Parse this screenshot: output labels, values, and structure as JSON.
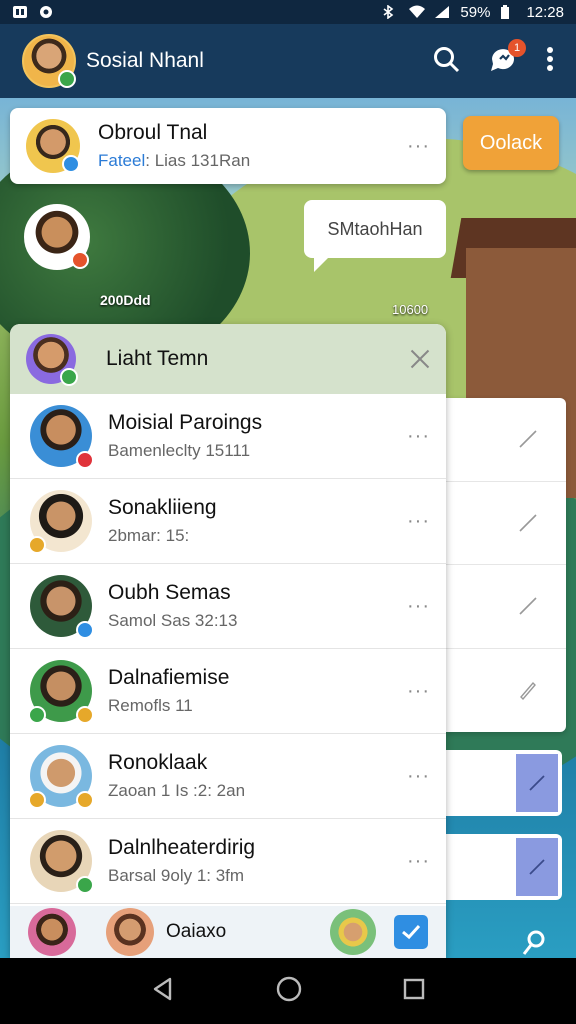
{
  "status_bar": {
    "battery": "59%",
    "time": "12:28"
  },
  "app_bar": {
    "title": "Sosial Nhanl",
    "notification_count": "1"
  },
  "top_card": {
    "name": "Obroul Tnal",
    "sub_highlight": "Fateel",
    "sub_rest": ": Lias 131Ran",
    "menu": "···"
  },
  "orange_button": "Oolack",
  "speech_bubble": "SMtaohHan",
  "scene_labels": {
    "left": "200Ddd",
    "right": "10600"
  },
  "panel": {
    "title": "Liaht Temn",
    "rows": [
      {
        "name": "Moisial Paroings",
        "sub": "Bamenleclty 15111",
        "menu": "···"
      },
      {
        "name": "Sonakliieng",
        "sub": "2bmar: 15:",
        "menu": "···"
      },
      {
        "name": "Oubh Semas",
        "sub": "Samol Sas 32:13",
        "menu": "···"
      },
      {
        "name": "Dalnafiemise",
        "sub": "Remofls 11",
        "menu": "···"
      },
      {
        "name": "Ronoklaak",
        "sub": "Zaoan 1 Is :2: 2an",
        "menu": "···"
      },
      {
        "name": "Dalnlheaterdirig",
        "sub": "Barsal 9oly 1: 3fm",
        "menu": "···"
      }
    ],
    "footer_label": "Oaiaxo"
  },
  "colors": {
    "app_bar": "#173a5c",
    "accent_blue": "#2f8ee2",
    "orange": "#f0a238",
    "notification": "#e5532b",
    "panel_header": "#d5e2cc"
  }
}
